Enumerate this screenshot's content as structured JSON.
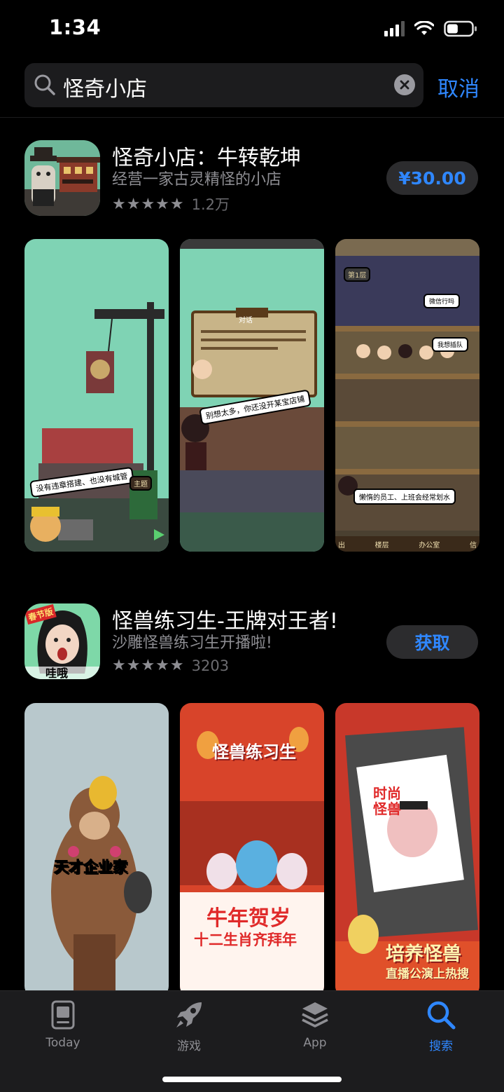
{
  "status_bar": {
    "time": "1:34",
    "signal_bars": 3,
    "battery_level": 0.45
  },
  "search": {
    "query": "怪奇小店",
    "cancel_label": "取消"
  },
  "results": [
    {
      "title": "怪奇小店：牛转乾坤",
      "subtitle": "经营一家古灵精怪的小店",
      "stars": "★★★★★",
      "rating_count": "1.2万",
      "action_label": "¥30.00",
      "screenshots": [
        {
          "captions": [
            "没有违章搭建、也没有城管"
          ],
          "sign": "主题"
        },
        {
          "header": "对话",
          "captions": [
            "别想太多，你还没开某宝店铺"
          ]
        },
        {
          "floor": "第1层",
          "captions": [
            "微信行吗",
            "我想插队",
            "懒惰的员工、上班会经常划水"
          ],
          "bottom_tabs": [
            "出",
            "楼层",
            "办公室",
            "信"
          ]
        }
      ]
    },
    {
      "title": "怪兽练习生-王牌对王者!",
      "subtitle": "沙雕怪兽练习生开播啦!",
      "stars": "★★★★★",
      "rating_count": "3203",
      "action_label": "获取",
      "icon_badge": "春节版",
      "icon_text": "哇哦",
      "screenshots": [
        {
          "banner": "天才企业家"
        },
        {
          "logo": "怪兽练习生",
          "headline": "牛年贺岁",
          "subline": "十二生肖齐拜年"
        },
        {
          "tag": "时尚怪兽",
          "headline": "培养怪兽",
          "subline": "直播公演上热搜"
        }
      ]
    }
  ],
  "tab_bar": [
    {
      "label": "Today",
      "icon": "today-icon"
    },
    {
      "label": "游戏",
      "icon": "rocket-icon"
    },
    {
      "label": "App",
      "icon": "layers-icon"
    },
    {
      "label": "搜索",
      "icon": "search-icon",
      "active": true
    }
  ],
  "colors": {
    "accent": "#2f87ff",
    "background": "#000000",
    "button_bg": "#2c2c2e"
  }
}
